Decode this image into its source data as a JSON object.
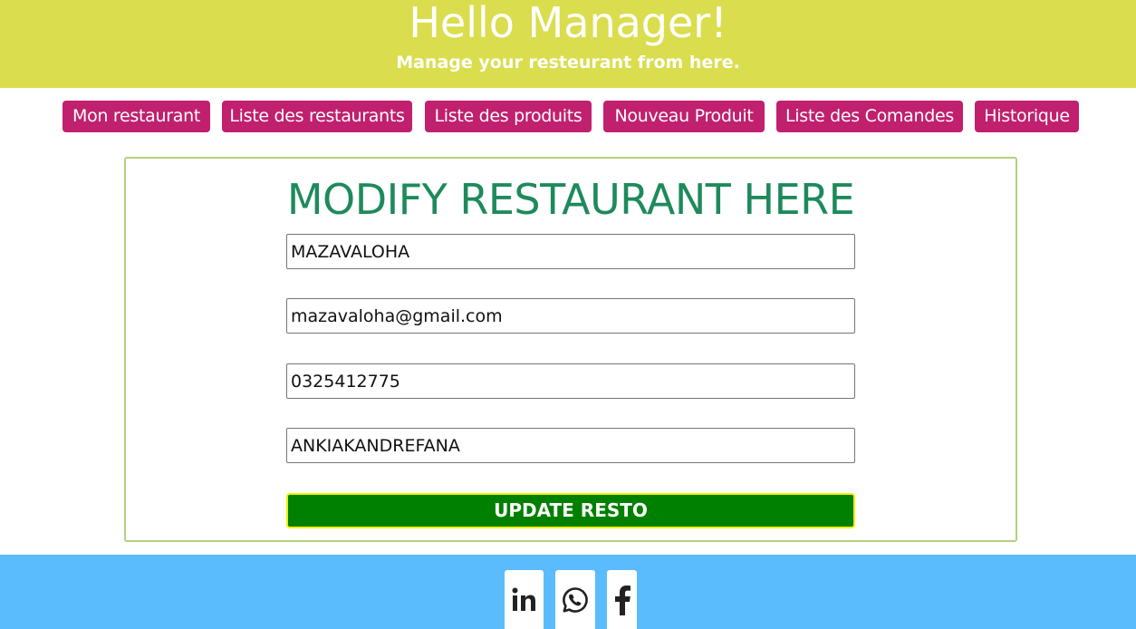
{
  "header": {
    "title": "Hello Manager!",
    "subtitle": "Manage your resteurant from here."
  },
  "nav": {
    "items": [
      {
        "label": "Mon restaurant"
      },
      {
        "label": "Liste des restaurants"
      },
      {
        "label": "Liste des produits"
      },
      {
        "label": "Nouveau Produit"
      },
      {
        "label": "Liste des Comandes"
      },
      {
        "label": "Historique"
      }
    ]
  },
  "form": {
    "title": "MODIFY RESTAURANT HERE",
    "fields": {
      "name": "MAZAVALOHA",
      "email": "mazavaloha@gmail.com",
      "phone": "0325412775",
      "address": "ANKIAKANDREFANA"
    },
    "submit_label": "UPDATE RESTO"
  },
  "footer": {
    "icons": [
      "linkedin-icon",
      "whatsapp-icon",
      "facebook-icon"
    ]
  },
  "colors": {
    "header_bg": "#dadd4d",
    "nav_button_bg": "#c0206e",
    "title_color": "#1e8a5c",
    "submit_bg": "#008000",
    "submit_border": "#f2f000",
    "footer_bg": "#5bbcfd",
    "card_border": "#b3d17f"
  }
}
